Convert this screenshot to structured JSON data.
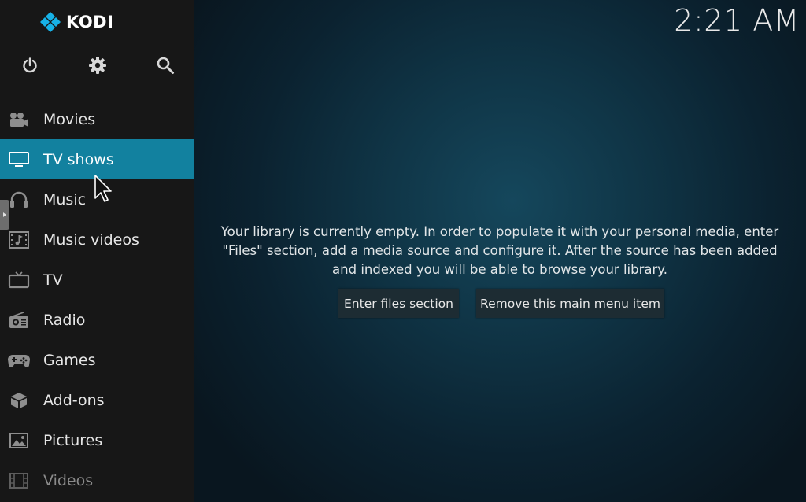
{
  "app": {
    "logo_text": "KODI",
    "clock": "2:21 AM"
  },
  "top_icons": [
    {
      "name": "power-icon"
    },
    {
      "name": "gear-icon"
    },
    {
      "name": "search-icon"
    }
  ],
  "menu": {
    "items": [
      {
        "label": "Movies",
        "icon": "movie-camera-icon",
        "active": false
      },
      {
        "label": "TV shows",
        "icon": "monitor-icon",
        "active": true
      },
      {
        "label": "Music",
        "icon": "headphones-icon",
        "active": false
      },
      {
        "label": "Music videos",
        "icon": "music-video-icon",
        "active": false
      },
      {
        "label": "TV",
        "icon": "tv-icon",
        "active": false
      },
      {
        "label": "Radio",
        "icon": "radio-icon",
        "active": false
      },
      {
        "label": "Games",
        "icon": "gamepad-icon",
        "active": false
      },
      {
        "label": "Add-ons",
        "icon": "addons-box-icon",
        "active": false
      },
      {
        "label": "Pictures",
        "icon": "picture-icon",
        "active": false
      },
      {
        "label": "Videos",
        "icon": "film-strip-icon",
        "active": false
      }
    ]
  },
  "main": {
    "message_line1": "Your library is currently empty. In order to populate it with your personal media, enter",
    "message_line2": "\"Files\" section, add a media source and configure it. After the source has been added",
    "message_line3": "and indexed you will be able to browse your library.",
    "button_enter_files": "Enter files section",
    "button_remove_item": "Remove this main menu item"
  },
  "colors": {
    "sidebar_bg": "#171717",
    "active_item_bg": "#12819f",
    "main_bg": "#0f3344",
    "button_bg": "#1d2c33",
    "logo_blue": "#17b2e7"
  }
}
